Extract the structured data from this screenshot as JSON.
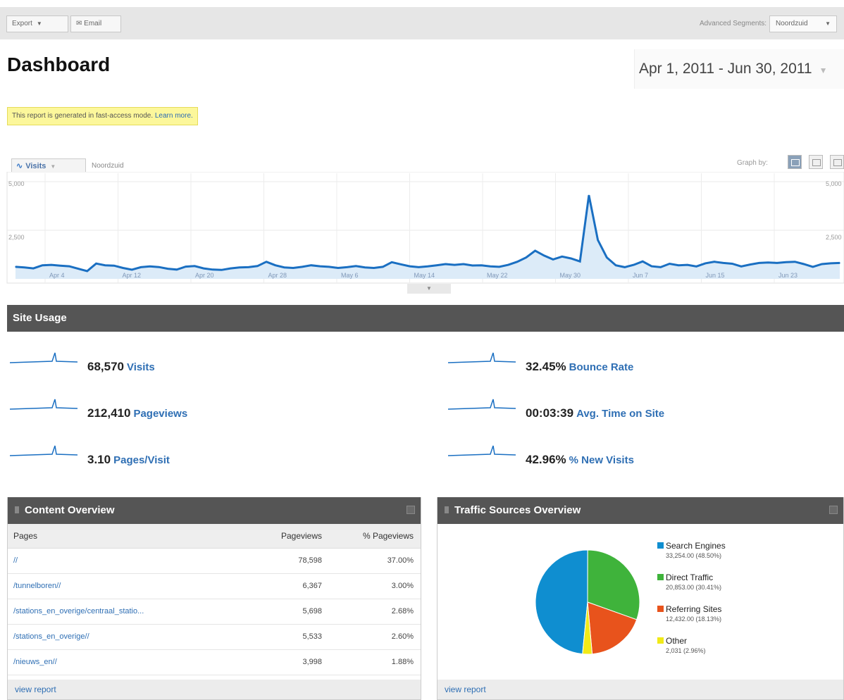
{
  "toolbar": {
    "export_label": "Export",
    "email_label": "Email",
    "segments_label": "Advanced Segments:",
    "segment_value": "Noordzuid"
  },
  "page_title": "Dashboard",
  "date_range": "Apr 1, 2011 - Jun 30, 2011",
  "notice": {
    "text": "This report is generated in fast-access mode.",
    "link": "Learn more."
  },
  "graph": {
    "metric": "Visits",
    "segment": "Noordzuid",
    "graph_by_label": "Graph by:",
    "y_top_left": "5,000",
    "y_mid_left": "2,500",
    "y_top_right": "5,000",
    "y_mid_right": "2,500",
    "date_labels": [
      "Apr 4",
      "Apr 12",
      "Apr 20",
      "Apr 28",
      "May 6",
      "May 14",
      "May 22",
      "May 30",
      "Jun 7",
      "Jun 15",
      "Jun 23"
    ]
  },
  "chart_data": {
    "type": "area",
    "series": [
      {
        "name": "Visits",
        "values": [
          620,
          590,
          540,
          700,
          720,
          680,
          650,
          520,
          400,
          790,
          700,
          680,
          560,
          470,
          600,
          640,
          610,
          520,
          480,
          630,
          660,
          540,
          480,
          460,
          540,
          590,
          600,
          660,
          880,
          700,
          590,
          560,
          620,
          700,
          650,
          620,
          560,
          600,
          660,
          590,
          560,
          620,
          860,
          750,
          650,
          600,
          640,
          700,
          760,
          720,
          760,
          690,
          700,
          640,
          620,
          720,
          880,
          1100,
          1450,
          1200,
          1000,
          1150,
          1050,
          900,
          4300,
          2000,
          1100,
          700,
          600,
          720,
          900,
          650,
          600,
          780,
          700,
          720,
          640,
          800,
          880,
          820,
          780,
          640,
          740,
          820,
          840,
          820,
          860,
          880,
          760,
          620,
          760,
          800,
          820
        ]
      }
    ],
    "ylim": [
      0,
      5000
    ]
  },
  "site_usage": {
    "title": "Site Usage",
    "metrics": [
      {
        "value": "68,570",
        "label": "Visits"
      },
      {
        "value": "32.45%",
        "label": "Bounce Rate"
      },
      {
        "value": "212,410",
        "label": "Pageviews"
      },
      {
        "value": "00:03:39",
        "label": "Avg. Time on Site"
      },
      {
        "value": "3.10",
        "label": "Pages/Visit"
      },
      {
        "value": "42.96%",
        "label": "% New Visits"
      }
    ]
  },
  "content_overview": {
    "title": "Content Overview",
    "columns": [
      "Pages",
      "Pageviews",
      "% Pageviews"
    ],
    "rows": [
      {
        "page": "//",
        "views": "78,598",
        "pct": "37.00%"
      },
      {
        "page": "/tunnelboren//",
        "views": "6,367",
        "pct": "3.00%"
      },
      {
        "page": "/stations_en_overige/centraal_statio...",
        "views": "5,698",
        "pct": "2.68%"
      },
      {
        "page": "/stations_en_overige//",
        "views": "5,533",
        "pct": "2.60%"
      },
      {
        "page": "/nieuws_en//",
        "views": "3,998",
        "pct": "1.88%"
      }
    ],
    "view_report": "view report"
  },
  "traffic_sources": {
    "title": "Traffic Sources Overview",
    "items": [
      {
        "name": "Search Engines",
        "value": "33,254.00 (48.50%)",
        "pct": 48.5,
        "color": "#0f8ed0"
      },
      {
        "name": "Direct Traffic",
        "value": "20,853.00 (30.41%)",
        "pct": 30.41,
        "color": "#3fb33b"
      },
      {
        "name": "Referring Sites",
        "value": "12,432.00 (18.13%)",
        "pct": 18.13,
        "color": "#e8531c"
      },
      {
        "name": "Other",
        "value": "2,031 (2.96%)",
        "pct": 2.96,
        "color": "#f1ea18"
      }
    ],
    "view_report": "view report"
  }
}
